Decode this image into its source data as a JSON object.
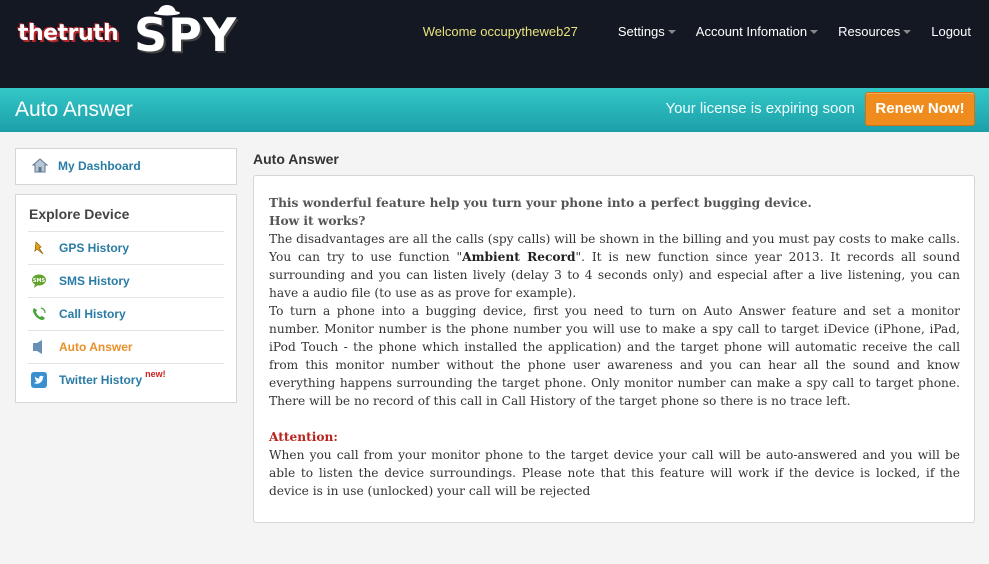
{
  "brand": {
    "prefix": "thetruth",
    "name": "SPY"
  },
  "nav": {
    "welcome": "Welcome occupytheweb27",
    "items": [
      {
        "label": "Settings",
        "dropdown": true
      },
      {
        "label": "Account Infomation",
        "dropdown": true
      },
      {
        "label": "Resources",
        "dropdown": true
      },
      {
        "label": "Logout",
        "dropdown": false
      }
    ]
  },
  "band": {
    "title": "Auto Answer",
    "license_notice": "Your license is expiring soon",
    "renew_label": "Renew Now!"
  },
  "sidebar": {
    "dashboard": {
      "label": "My Dashboard",
      "icon": "home-icon"
    },
    "explore_heading": "Explore Device",
    "items": [
      {
        "label": "GPS History",
        "icon": "gps-pin-icon"
      },
      {
        "label": "SMS History",
        "icon": "sms-bubble-icon"
      },
      {
        "label": "Call History",
        "icon": "phone-icon"
      },
      {
        "label": "Auto Answer",
        "icon": "auto-answer-icon",
        "active": true
      },
      {
        "label": "Twitter History",
        "icon": "twitter-icon",
        "badge": "new!"
      }
    ]
  },
  "main": {
    "title": "Auto Answer",
    "lead1": "This wonderful feature help you turn your phone into a perfect bugging device.",
    "lead2": "How it works?",
    "p1_a": "The disadvantages are all the calls (spy calls) will be shown in the billing and you must pay costs to make calls. You can try to use function \"",
    "p1_bold": "Ambient Record",
    "p1_b": "\". It is new function since year 2013. It records all sound surrounding and you can listen lively (delay 3 to 4 seconds only) and especial after a live listening, you can have a audio file (to use as as prove for example).",
    "p2": "To turn a phone into a bugging device, first you need to turn on Auto Answer feature and set a monitor number. Monitor number is the phone number you will use to make a spy call to target iDevice (iPhone, iPad, iPod Touch - the phone which installed the application) and the target phone will automatic receive the call from this monitor number without the phone user awareness and you can hear all the sound and know everything happens surrounding the target phone. Only monitor number can make a spy call to target phone. There will be no record of this call in Call History of the target phone so there is no trace left.",
    "attention_label": "Attention:",
    "attention_text": "When you call from your monitor phone to the target device your call will be auto-answered and you will be able to listen the device surroundings. Please note that this feature will work if the device is locked, if the device is in use (unlocked) your call will be rejected"
  },
  "colors": {
    "header_bg": "#131823",
    "band_teal": "#23acb3",
    "renew_orange": "#f08c1d",
    "link_blue": "#2a7ca4",
    "active_orange": "#e8902a",
    "attention_red": "#b8241d"
  }
}
